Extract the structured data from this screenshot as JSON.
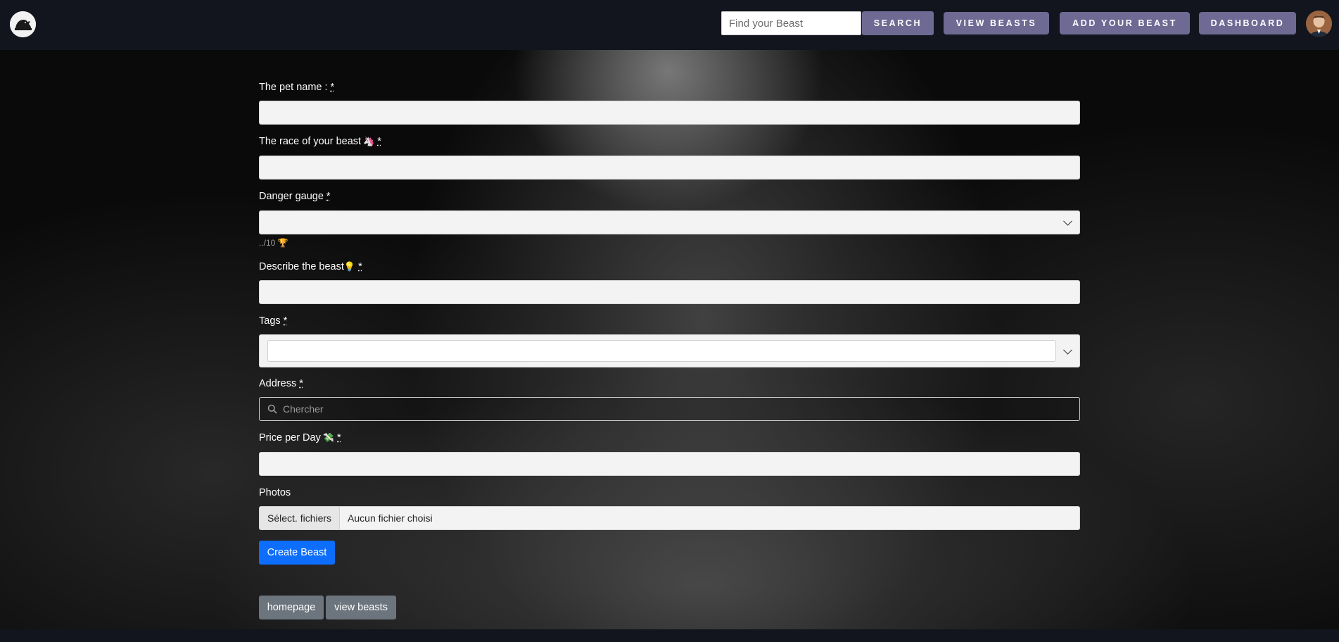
{
  "navbar": {
    "search_placeholder": "Find your Beast",
    "search_label": "SEARCH",
    "view_beasts_label": "VIEW BEASTS",
    "add_beast_label": "ADD YOUR BEAST",
    "dashboard_label": "DASHBOARD",
    "accent_color": "#6e6a94"
  },
  "form": {
    "name_label": "The pet name :",
    "race_label": "The race of your beast",
    "race_emoji": "🦄",
    "danger_label": "Danger gauge",
    "danger_hint": "../10",
    "danger_hint_emoji": "🏆",
    "describe_label": "Describe the beast",
    "describe_emoji": "💡",
    "tags_label": "Tags",
    "address_label": "Address",
    "address_placeholder": "Chercher",
    "price_label": "Price per Day",
    "price_emoji": "💸",
    "photos_label": "Photos",
    "file_button_label": "Sélect. fichiers",
    "file_status": "Aucun fichier choisi",
    "required_mark": "*",
    "submit_label": "Create Beast",
    "submit_color": "#0d6efd"
  },
  "links": {
    "homepage_label": "homepage",
    "view_beasts_label": "view beasts"
  }
}
